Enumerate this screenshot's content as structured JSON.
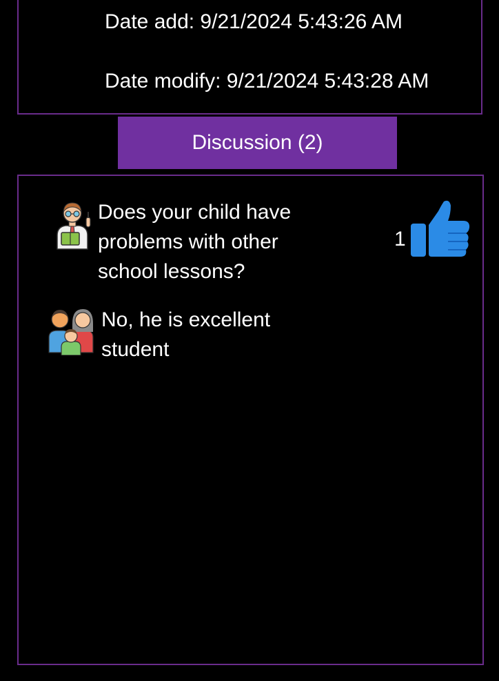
{
  "record": {
    "date_add": "Date add: 9/21/2024 5:43:26 AM",
    "date_modify": "Date modify: 9/21/2024 5:43:28 AM"
  },
  "discussion": {
    "tab_label": "Discussion (2)",
    "messages": [
      {
        "author_icon": "teacher-icon",
        "text": "Does your child have problems with other school lessons?",
        "likes": "1"
      },
      {
        "author_icon": "family-icon",
        "text": "No, he is excellent student"
      }
    ]
  },
  "colors": {
    "background": "#000000",
    "accent": "#7030a0",
    "border": "#6a2c8c",
    "like": "#1f7ad6"
  }
}
